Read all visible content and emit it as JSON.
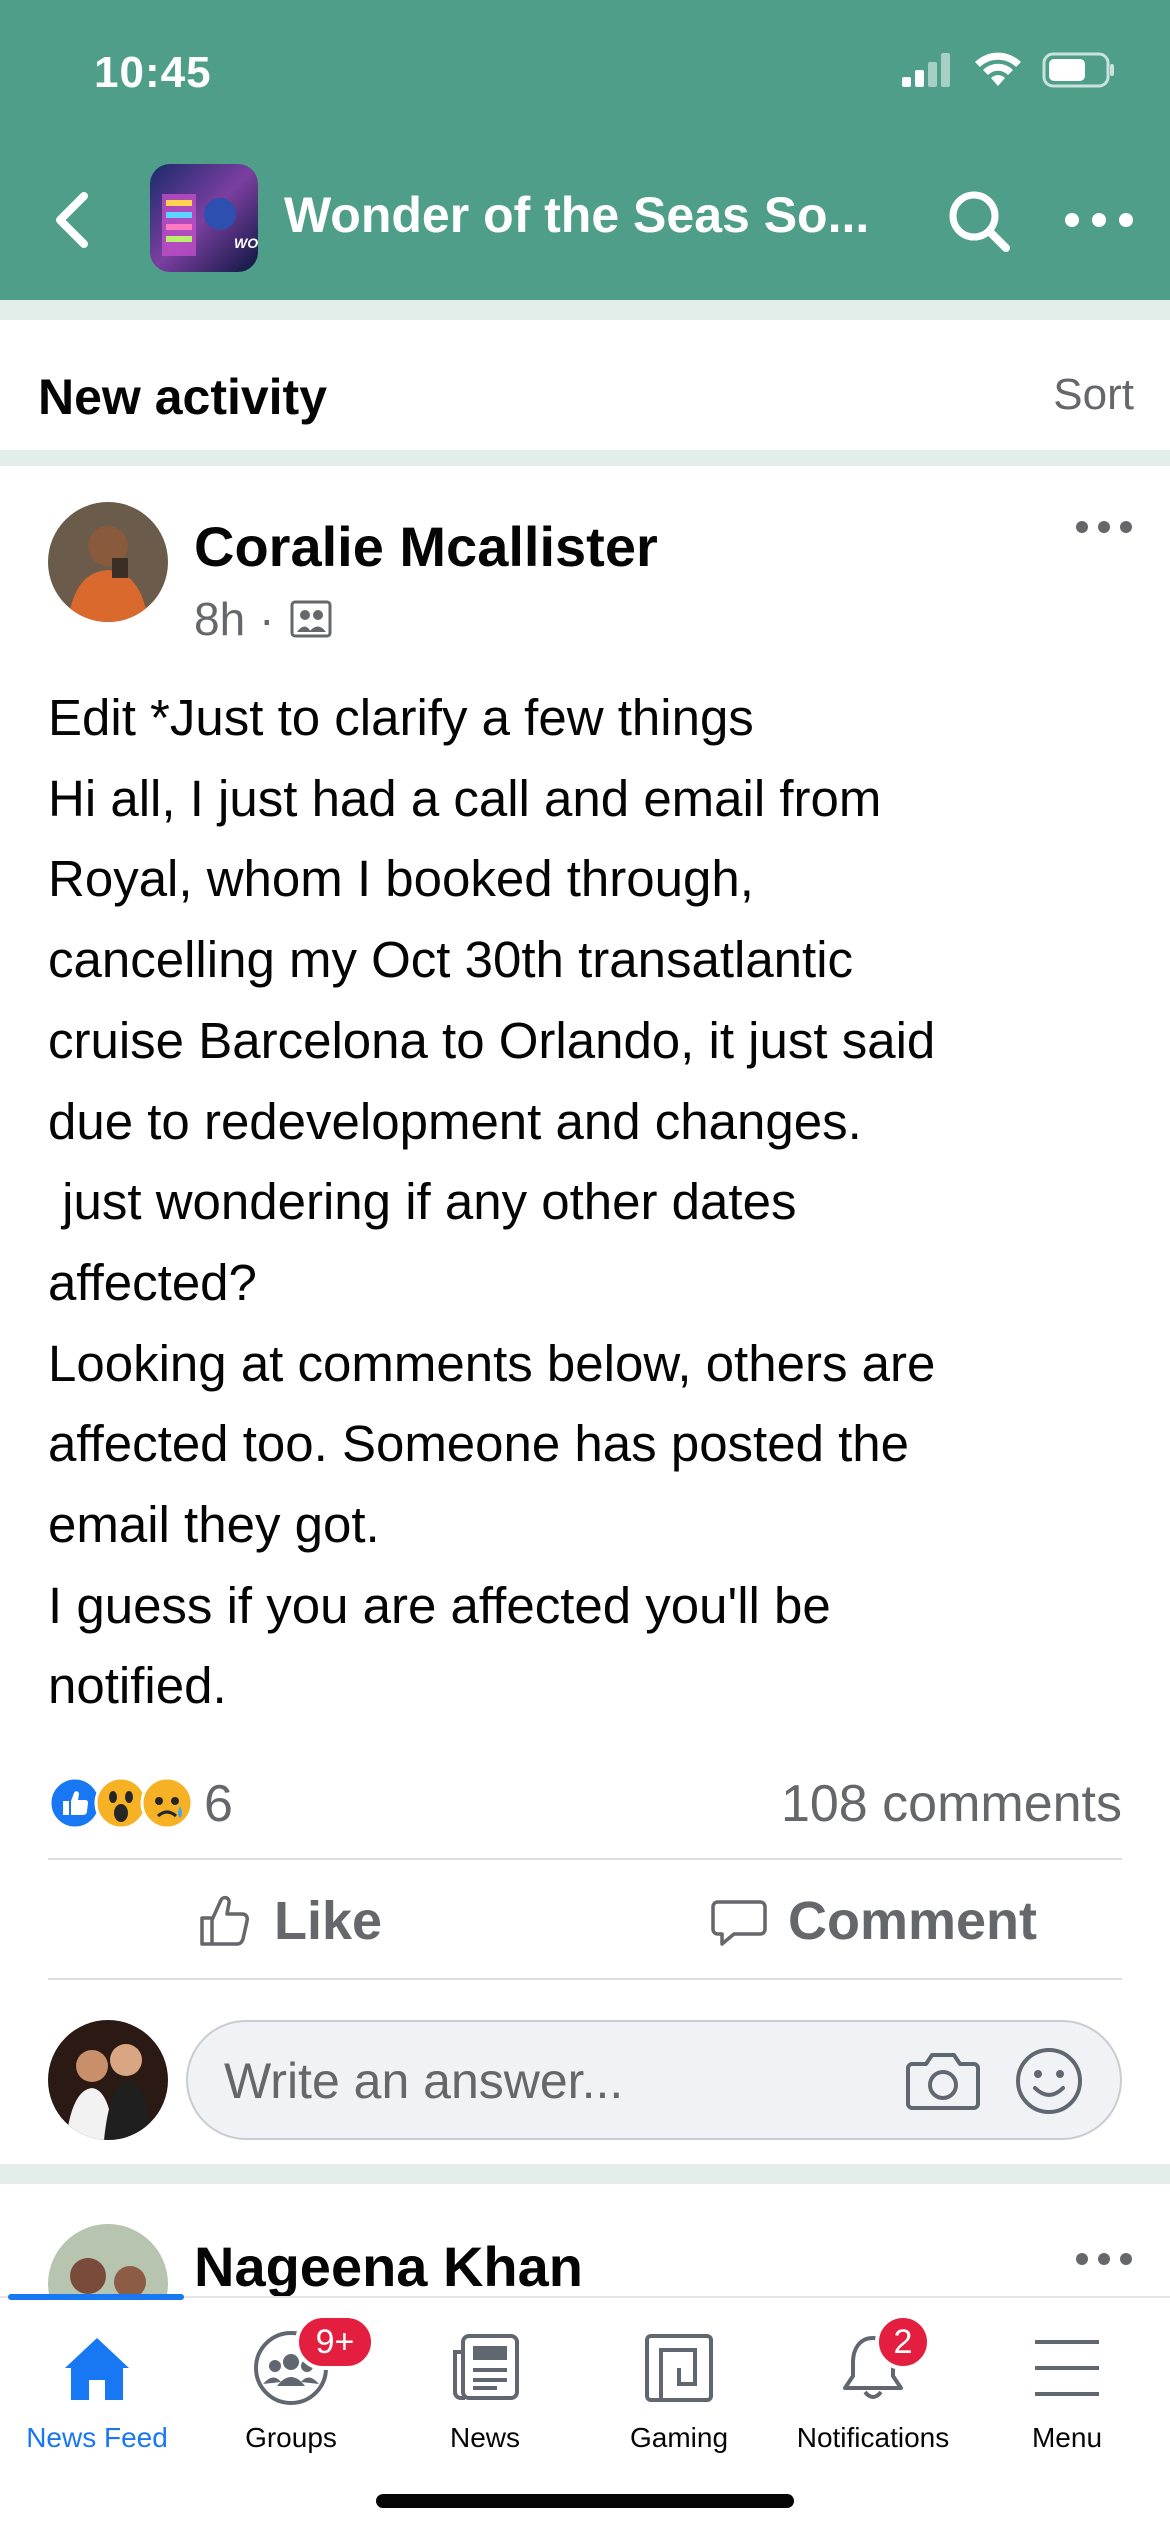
{
  "status_bar": {
    "time": "10:45"
  },
  "header": {
    "group_title": "Wonder of the Seas So...",
    "group_thumb_text": "WON",
    "color": "#4e9e8a"
  },
  "activity": {
    "title": "New activity",
    "sort_label": "Sort"
  },
  "post": {
    "author": "Coralie Mcallister",
    "time": "8h",
    "separator": "·",
    "body_lines": [
      "Edit *Just to clarify a few things",
      "Hi all, I just had a call and email from",
      "Royal, whom I booked through,",
      "cancelling my Oct 30th transatlantic",
      "cruise Barcelona to Orlando, it just said",
      "due to redevelopment and changes.",
      " just wondering if any other dates",
      "affected?",
      "Looking at comments below, others are",
      "affected too. Someone has posted the",
      "email they got.",
      "I guess if you are affected you'll be",
      "notified."
    ],
    "reactions": [
      "like",
      "wow",
      "sad"
    ],
    "reaction_count": "6",
    "comment_count": "108 comments",
    "like_label": "Like",
    "comment_label": "Comment",
    "composer_placeholder": "Write an answer..."
  },
  "next_post": {
    "author": "Nageena Khan"
  },
  "tabbar": {
    "accent": "#1877f2",
    "tabs": [
      {
        "label": "News Feed",
        "icon": "home-icon",
        "active": true
      },
      {
        "label": "Groups",
        "icon": "groups-icon",
        "badge": "9+"
      },
      {
        "label": "News",
        "icon": "news-icon"
      },
      {
        "label": "Gaming",
        "icon": "gaming-icon"
      },
      {
        "label": "Notifications",
        "icon": "bell-icon",
        "badge": "2"
      },
      {
        "label": "Menu",
        "icon": "menu-icon"
      }
    ]
  }
}
